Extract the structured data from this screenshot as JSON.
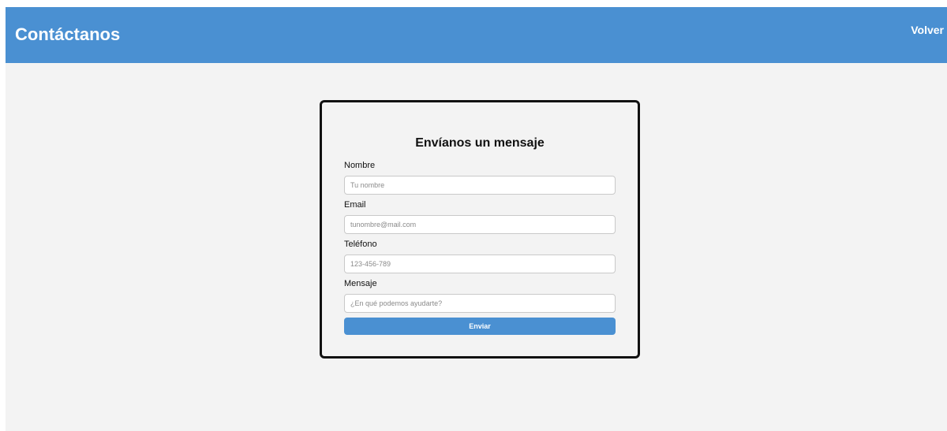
{
  "header": {
    "title": "Contáctanos",
    "back_label": "Volver"
  },
  "form": {
    "title": "Envíanos un mensaje",
    "fields": [
      {
        "label": "Nombre",
        "placeholder": "Tu nombre",
        "value": ""
      },
      {
        "label": "Email",
        "placeholder": "tunombre@mail.com",
        "value": ""
      },
      {
        "label": "Teléfono",
        "placeholder": "123-456-789",
        "value": ""
      },
      {
        "label": "Mensaje",
        "placeholder": "¿En qué podemos ayudarte?",
        "value": ""
      }
    ],
    "submit_label": "Enviar"
  },
  "colors": {
    "header_background": "#4a90d2",
    "page_background": "#f3f3f3",
    "button_background": "#4a90d2",
    "card_border": "#111111"
  }
}
